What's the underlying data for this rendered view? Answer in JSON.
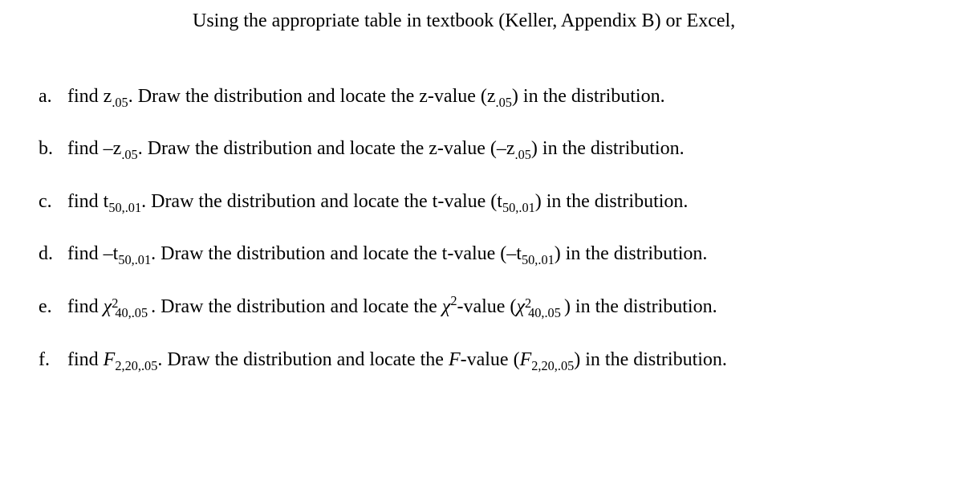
{
  "intro": "Using the appropriate table in textbook (Keller, Appendix B) or Excel,",
  "items": {
    "a": {
      "bullet": "a.",
      "prefix": "find z",
      "sub1": ".05",
      "mid1": ". Draw the distribution and locate the z-value (z",
      "sub2": ".05",
      "suffix": ") in the distribution."
    },
    "b": {
      "bullet": "b.",
      "prefix": "find –z",
      "sub1": ".05",
      "mid1": ". Draw the distribution and locate the z-value (–z",
      "sub2": ".05",
      "suffix": ") in the distribution."
    },
    "c": {
      "bullet": "c.",
      "prefix": "find t",
      "sub1": "50,.01",
      "mid1": ". Draw the distribution and locate the t-value (t",
      "sub2": "50,.01",
      "suffix": ") in the distribution."
    },
    "d": {
      "bullet": "d.",
      "prefix": "find –t",
      "sub1": "50,.01",
      "mid1": ". Draw the distribution and locate the t-value (–t",
      "sub2": "50,.01",
      "suffix": ") in the distribution."
    },
    "e": {
      "bullet": "e.",
      "prefix": "find ",
      "chi": "χ",
      "sup1": "2",
      "sub1": "40,.05",
      "mid1": ". Draw the distribution and locate the ",
      "chisq": "χ",
      "sup_mid": "2",
      "mid2": "-value (",
      "chi2": "χ",
      "sup2": "2",
      "sub2": "40,.05",
      "suffix": ") in the distribution."
    },
    "f": {
      "bullet": "f.",
      "prefix": "find ",
      "F": "F",
      "sub1": "2,20,.05",
      "mid1": ". Draw the distribution and locate the ",
      "Fmid": "F",
      "mid2": "-value (",
      "F2": "F",
      "sub2": "2,20,.05",
      "suffix": ") in the distribution."
    }
  }
}
